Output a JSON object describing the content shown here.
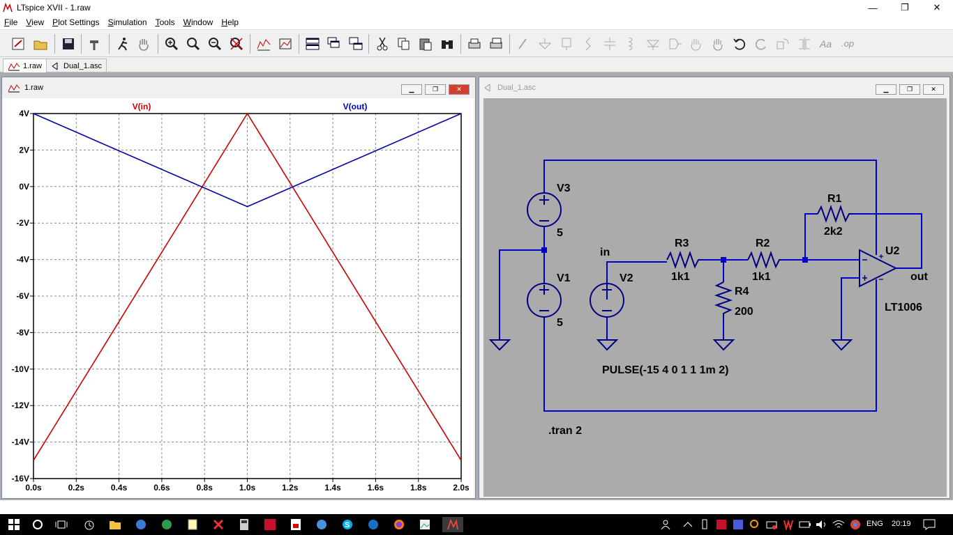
{
  "window": {
    "title": "LTspice XVII - 1.raw",
    "minimize": "—",
    "maximize": "❐",
    "close": "✕"
  },
  "menu": [
    {
      "key": "F",
      "rest": "ile"
    },
    {
      "key": "V",
      "rest": "iew"
    },
    {
      "key": "P",
      "rest": "lot Settings"
    },
    {
      "key": "S",
      "rest": "imulation"
    },
    {
      "key": "T",
      "rest": "ools"
    },
    {
      "key": "W",
      "rest": "indow"
    },
    {
      "key": "H",
      "rest": "elp"
    }
  ],
  "tabs": [
    {
      "label": "1.raw",
      "active": true,
      "icon": "waveform-icon"
    },
    {
      "label": "Dual_1.asc",
      "active": false,
      "icon": "schematic-icon"
    }
  ],
  "plot_window": {
    "title": "1.raw"
  },
  "schematic_window": {
    "title": "Dual_1.asc"
  },
  "chart_data": {
    "type": "line",
    "title": "",
    "xlabel": "",
    "ylabel": "",
    "xlim": [
      0,
      2
    ],
    "ylim": [
      -16,
      4
    ],
    "grid": true,
    "x_ticks": [
      "0.0s",
      "0.2s",
      "0.4s",
      "0.6s",
      "0.8s",
      "1.0s",
      "1.2s",
      "1.4s",
      "1.6s",
      "1.8s",
      "2.0s"
    ],
    "y_ticks": [
      "4V",
      "2V",
      "0V",
      "-2V",
      "-4V",
      "-6V",
      "-8V",
      "-10V",
      "-12V",
      "-14V",
      "-16V"
    ],
    "legend_position": "top",
    "series": [
      {
        "name": "V(in)",
        "color": "#cc0000",
        "x": [
          0,
          1,
          2
        ],
        "y": [
          -15,
          4,
          -15
        ]
      },
      {
        "name": "V(out)",
        "color": "#0000aa",
        "x": [
          0,
          1,
          2
        ],
        "y": [
          4,
          -1.1,
          4
        ]
      }
    ]
  },
  "schematic": {
    "labels": {
      "V3": "V3",
      "V3_val": "5",
      "V1": "V1",
      "V1_val": "5",
      "V2": "V2",
      "in": "in",
      "R3": "R3",
      "R3_val": "1k1",
      "R2": "R2",
      "R2_val": "1k1",
      "R1": "R1",
      "R1_val": "2k2",
      "R4": "R4",
      "R4_val": "200",
      "U2": "U2",
      "U2_model": "LT1006",
      "out": "out",
      "pulse": "PULSE(-15 4 0 1 1 1m 2)",
      "tran": ".tran 2"
    },
    "wire_color": "#0000cc",
    "component_color": "#000080"
  },
  "taskbar": {
    "lang": "ENG",
    "time": "20:19"
  },
  "colors": {
    "mdi_bg": "#ababab",
    "plot_bg": "#ffffff",
    "schematic_bg": "#ababab"
  }
}
